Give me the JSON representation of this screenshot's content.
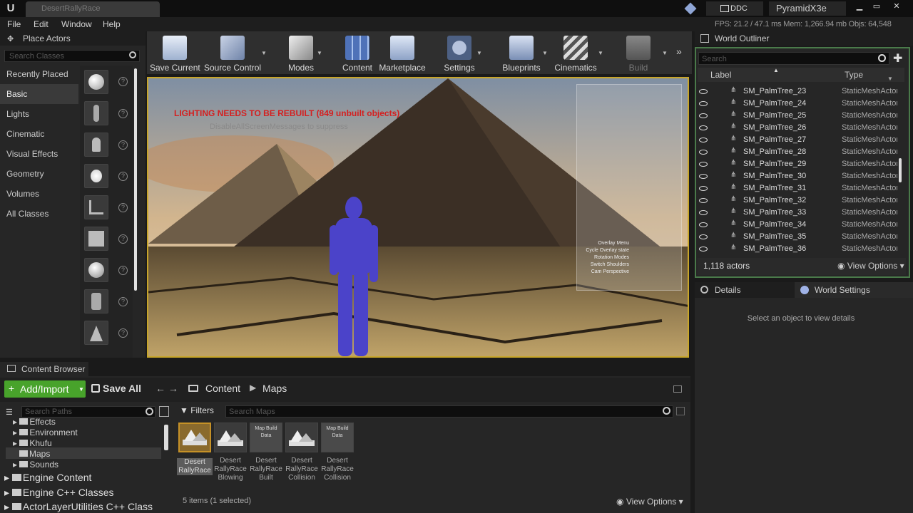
{
  "window": {
    "tab_title": "DesertRallyRace",
    "ddc": "DDC",
    "project": "PyramidX3e"
  },
  "menu": {
    "items": [
      "File",
      "Edit",
      "Window",
      "Help"
    ]
  },
  "perf": "FPS: 21.2  /  47.1 ms  Mem: 1,266.94 mb  Objs: 64,548",
  "place_actors": {
    "title": "Place Actors",
    "search_placeholder": "Search Classes",
    "categories": [
      "Recently Placed",
      "Basic",
      "Lights",
      "Cinematic",
      "Visual Effects",
      "Geometry",
      "Volumes",
      "All Classes"
    ],
    "active": "Basic"
  },
  "toolbar": {
    "items": [
      "Save Current",
      "Source Control",
      "Modes",
      "Content",
      "Marketplace",
      "Settings",
      "Blueprints",
      "Cinematics",
      "Build"
    ]
  },
  "viewport": {
    "lighting_warning": "LIGHTING NEEDS TO BE REBUILT (849 unbuilt objects)",
    "disable_message": "DisableAllScreenMessages to suppress",
    "debug_rows": [
      "Overlay Menu",
      "Cycle Overlay state",
      "Rotation Modes",
      "Switch Shoulders",
      "Cam Perspective"
    ]
  },
  "content_browser": {
    "tab": "Content Browser",
    "add_import": "Add/Import",
    "save_all": "Save All",
    "crumb_content": "Content",
    "crumb_maps": "Maps",
    "path_search_placeholder": "Search Paths",
    "tree": [
      "Effects",
      "Environment",
      "Khufu",
      "Maps",
      "Sounds"
    ],
    "tree_big": [
      "Engine Content",
      "Engine C++ Classes",
      "ActorLayerUtilities C++ Class"
    ],
    "filters": "Filters",
    "map_search_placeholder": "Search Maps",
    "assets": [
      {
        "label": "Desert RallyRace",
        "thumb": ""
      },
      {
        "label": "Desert RallyRace Blowing",
        "thumb": ""
      },
      {
        "label": "Desert RallyRace Built",
        "thumb": "Map Build Data"
      },
      {
        "label": "Desert RallyRace Collision",
        "thumb": ""
      },
      {
        "label": "Desert RallyRace Collision",
        "thumb": "Map Build Data"
      }
    ],
    "items_count": "5 items (1 selected)",
    "view_options": "View Options"
  },
  "outliner": {
    "tab": "World Outliner",
    "search_placeholder": "Search",
    "col_label": "Label",
    "col_type": "Type",
    "rows": [
      {
        "name": "SM_PalmTree_23",
        "type": "StaticMeshActor"
      },
      {
        "name": "SM_PalmTree_24",
        "type": "StaticMeshActor"
      },
      {
        "name": "SM_PalmTree_25",
        "type": "StaticMeshActor"
      },
      {
        "name": "SM_PalmTree_26",
        "type": "StaticMeshActor"
      },
      {
        "name": "SM_PalmTree_27",
        "type": "StaticMeshActor"
      },
      {
        "name": "SM_PalmTree_28",
        "type": "StaticMeshActor"
      },
      {
        "name": "SM_PalmTree_29",
        "type": "StaticMeshActor"
      },
      {
        "name": "SM_PalmTree_30",
        "type": "StaticMeshActor"
      },
      {
        "name": "SM_PalmTree_31",
        "type": "StaticMeshActor"
      },
      {
        "name": "SM_PalmTree_32",
        "type": "StaticMeshActor"
      },
      {
        "name": "SM_PalmTree_33",
        "type": "StaticMeshActor"
      },
      {
        "name": "SM_PalmTree_34",
        "type": "StaticMeshActor"
      },
      {
        "name": "SM_PalmTree_35",
        "type": "StaticMeshActor"
      },
      {
        "name": "SM_PalmTree_36",
        "type": "StaticMeshActor"
      }
    ],
    "actors": "1,118 actors",
    "view_options": "View Options"
  },
  "details": {
    "tab": "Details",
    "world_settings_tab": "World Settings",
    "empty_message": "Select an object to view details"
  },
  "colors": {
    "accent_green": "#48a32b",
    "viewport_border": "#c7a52a",
    "warning_red": "#d42020"
  }
}
